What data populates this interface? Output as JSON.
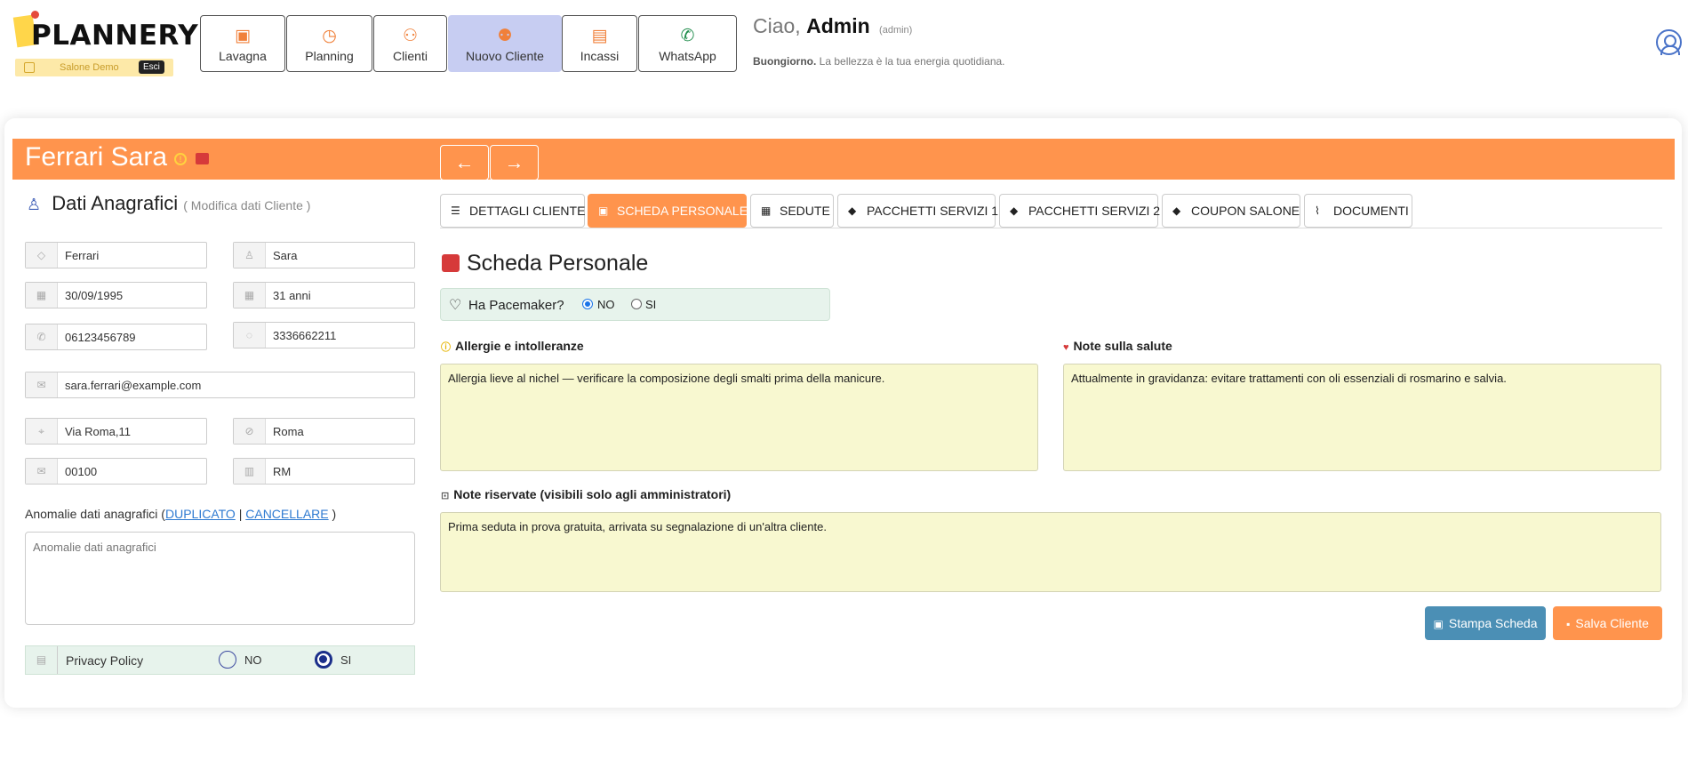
{
  "app": {
    "logo_text": "PLANNERY",
    "salon_name": "Salone Demo",
    "logout_label": "Esci"
  },
  "nav": [
    {
      "label": "Lavagna",
      "icon": "board-icon"
    },
    {
      "label": "Planning",
      "icon": "calendar-clock-icon"
    },
    {
      "label": "Clienti",
      "icon": "users-icon"
    },
    {
      "label": "Nuovo Cliente",
      "icon": "add-user-icon",
      "active": true
    },
    {
      "label": "Incassi",
      "icon": "cash-icon"
    },
    {
      "label": "WhatsApp",
      "icon": "whatsapp-icon"
    }
  ],
  "greeting": {
    "hello": "Ciao,",
    "name": "Admin",
    "role": "(admin)",
    "bold": "Buongiorno.",
    "message": "La bellezza è la tua energia quotidiana."
  },
  "client": {
    "name": "Ferrari Sara"
  },
  "anagrafica": {
    "title": "Dati Anagrafici",
    "subtitle": "( Modifica dati Cliente )",
    "cognome": "Ferrari",
    "nome": "Sara",
    "data_nascita": "30/09/1995",
    "eta": "31 anni",
    "telefono": "06123456789",
    "cellulare": "3336662211",
    "email": "sara.ferrari@example.com",
    "indirizzo": "Via Roma,11",
    "citta": "Roma",
    "cap": "00100",
    "provincia": "RM",
    "anomalie_label": "Anomalie dati anagrafici (",
    "duplicato": "DUPLICATO",
    "separator": "|",
    "cancellare": "CANCELLARE",
    "close_paren": ")",
    "anomalie_placeholder": "Anomalie dati anagrafici",
    "privacy_label": "Privacy Policy",
    "privacy_no": "NO",
    "privacy_si": "SI",
    "privacy_value": "SI"
  },
  "tabs": [
    {
      "label": "DETTAGLI CLIENTE",
      "icon": "user-details-icon"
    },
    {
      "label": "SCHEDA PERSONALE",
      "icon": "clipboard-icon",
      "active": true
    },
    {
      "label": "SEDUTE",
      "icon": "calendar-icon"
    },
    {
      "label": "PACCHETTI SERVIZI 1",
      "icon": "tag-icon"
    },
    {
      "label": "PACCHETTI SERVIZI 2",
      "icon": "tag-icon"
    },
    {
      "label": "COUPON SALONE",
      "icon": "coupon-icon"
    },
    {
      "label": "DOCUMENTI",
      "icon": "paperclip-icon"
    }
  ],
  "scheda": {
    "title": "Scheda Personale",
    "pacemaker_label": "Ha Pacemaker?",
    "pacemaker_no": "NO",
    "pacemaker_si": "SI",
    "pacemaker_value": "NO",
    "allergie_label": "Allergie e intolleranze",
    "allergie_text": "Allergia lieve al nichel — verificare la composizione degli smalti prima della manicure.",
    "salute_label": "Note sulla salute",
    "salute_text": "Attualmente in gravidanza: evitare trattamenti con oli essenziali di rosmarino e salvia.",
    "riservate_label": "Note riservate (visibili solo agli amministratori)",
    "riservate_text": "Prima seduta in prova gratuita, arrivata su segnalazione di un'altra cliente."
  },
  "actions": {
    "print_label": "Stampa Scheda",
    "save_label": "Salva Cliente"
  },
  "colors": {
    "accent": "#ff944d",
    "active_nav": "#c7cdf2",
    "note_bg": "#f8f8d0",
    "print_button": "#4b8fb5"
  }
}
